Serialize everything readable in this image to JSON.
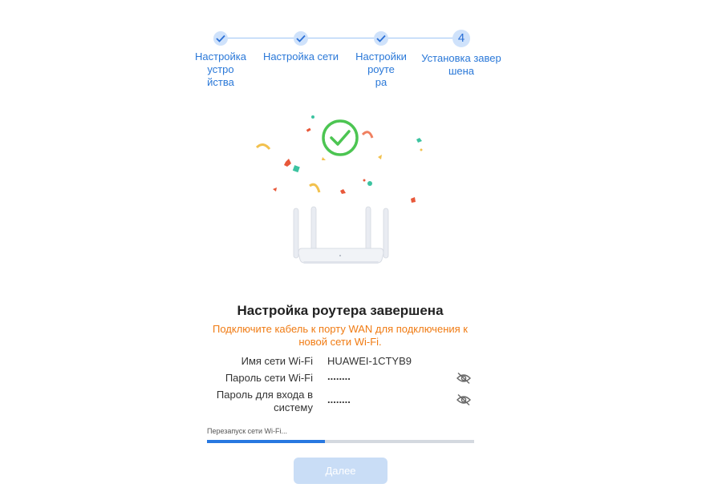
{
  "stepper": {
    "steps": [
      {
        "label": "Настройка устро\nйства",
        "state": "done"
      },
      {
        "label": "Настройка сети",
        "state": "done"
      },
      {
        "label": "Настройки роуте\nра",
        "state": "done"
      },
      {
        "label": "Установка завер\nшена",
        "state": "current",
        "number": "4"
      }
    ]
  },
  "main": {
    "title": "Настройка роутера завершена",
    "notice": "Подключите кабель к порту WAN для подключения к новой сети Wi-Fi.",
    "wifi_name_label": "Имя сети Wi-Fi",
    "wifi_name_value": "HUAWEI-1CTYB9",
    "wifi_password_label": "Пароль сети Wi-Fi",
    "wifi_password_value": "........",
    "login_password_label": "Пароль для входа в систему",
    "login_password_value": "........",
    "progress_label": "Перезапуск сети Wi-Fi...",
    "progress_fraction": 0.44,
    "next_button": "Далее"
  },
  "colors": {
    "accent": "#2878e0",
    "notice": "#f07b13",
    "success": "#4cc552",
    "button_disabled": "#c9ddf6"
  }
}
